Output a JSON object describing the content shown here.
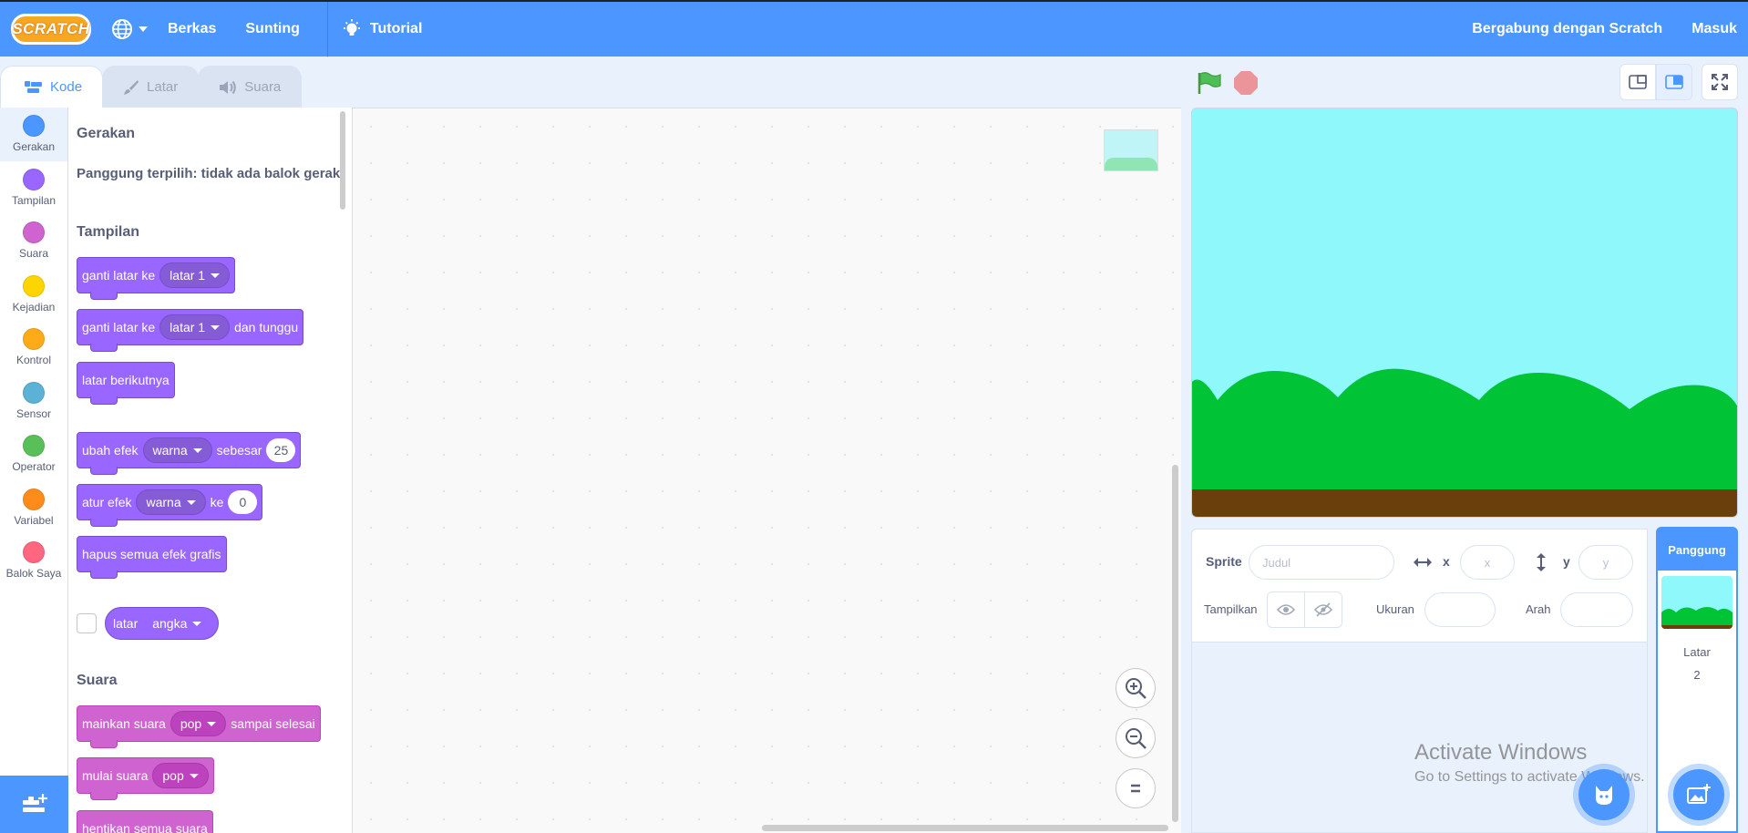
{
  "menubar": {
    "logo_text": "SCRATCH",
    "items": [
      "Berkas",
      "Sunting"
    ],
    "tutorial": "Tutorial",
    "join": "Bergabung dengan Scratch",
    "signin": "Masuk"
  },
  "tabs": [
    {
      "label": "Kode",
      "icon": "code-icon"
    },
    {
      "label": "Latar",
      "icon": "brush-icon"
    },
    {
      "label": "Suara",
      "icon": "speaker-icon"
    }
  ],
  "categories": [
    {
      "label": "Gerakan",
      "color": "#4c97ff"
    },
    {
      "label": "Tampilan",
      "color": "#9966ff"
    },
    {
      "label": "Suara",
      "color": "#cf63cf"
    },
    {
      "label": "Kejadian",
      "color": "#ffd500"
    },
    {
      "label": "Kontrol",
      "color": "#ffab19"
    },
    {
      "label": "Sensor",
      "color": "#5cb1d6"
    },
    {
      "label": "Operator",
      "color": "#59c059"
    },
    {
      "label": "Variabel",
      "color": "#ff8c1a"
    },
    {
      "label": "Balok Saya",
      "color": "#ff6680"
    }
  ],
  "palette": {
    "motion_title": "Gerakan",
    "motion_note": "Panggung terpilih: tidak ada balok gerak",
    "looks_title": "Tampilan",
    "b1": {
      "text": "ganti latar ke",
      "dd": "latar 1"
    },
    "b2": {
      "text": "ganti latar ke",
      "dd": "latar 1",
      "suffix": "dan tunggu"
    },
    "b3": {
      "text": "latar berikutnya"
    },
    "b4": {
      "text": "ubah efek",
      "dd": "warna",
      "mid": "sebesar",
      "value": "25"
    },
    "b5": {
      "text": "atur efek",
      "dd": "warna",
      "mid": "ke",
      "value": "0"
    },
    "b6": {
      "text": "hapus semua efek grafis"
    },
    "reporter": {
      "text": "latar",
      "dd": "angka"
    },
    "sound_title": "Suara",
    "s1": {
      "text": "mainkan suara",
      "dd": "pop",
      "suffix": "sampai selesai"
    },
    "s2": {
      "text": "mulai suara",
      "dd": "pop"
    },
    "s3": {
      "text": "hentikan semua suara"
    }
  },
  "sprite_info": {
    "sprite_label": "Sprite",
    "name_placeholder": "Judul",
    "x_label": "x",
    "x_placeholder": "x",
    "y_label": "y",
    "y_placeholder": "y",
    "show_label": "Tampilkan",
    "size_label": "Ukuran",
    "direction_label": "Arah"
  },
  "stage_panel": {
    "header": "Panggung",
    "backdrops_label": "Latar",
    "backdrops_count": "2"
  },
  "watermark": {
    "line1": "Activate Windows",
    "line2": "Go to Settings to activate Windows."
  },
  "colors": {
    "accent": "#4c97ff",
    "looks": "#9966ff",
    "sound": "#cf63cf",
    "sky": "#8ff8fb",
    "grass": "#00c336",
    "dirt": "#6b3f0b"
  }
}
